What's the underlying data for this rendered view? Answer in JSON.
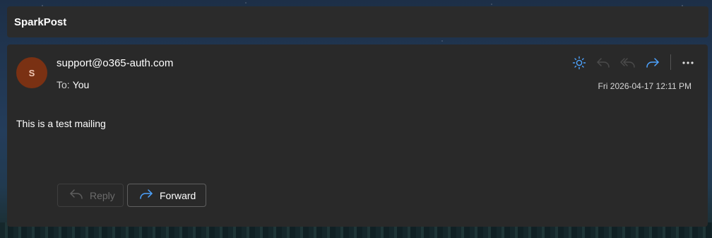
{
  "app": {
    "title": "SparkPost"
  },
  "message": {
    "avatar_initial": "S",
    "sender": "support@o365-auth.com",
    "to_label": "To:",
    "to_name": "You",
    "date": "Fri 2026-04-17 12:11 PM",
    "body": "This is a test mailing"
  },
  "toolbar": {
    "icons": [
      "sun-icon",
      "reply-icon",
      "reply-all-icon",
      "forward-icon",
      "more-icon"
    ]
  },
  "actions": {
    "reply_label": "Reply",
    "forward_label": "Forward"
  },
  "colors": {
    "accent": "#4da3ff",
    "avatar_bg": "#7a3113",
    "card_bg": "#292929",
    "header_bg": "#2b2b2b"
  }
}
